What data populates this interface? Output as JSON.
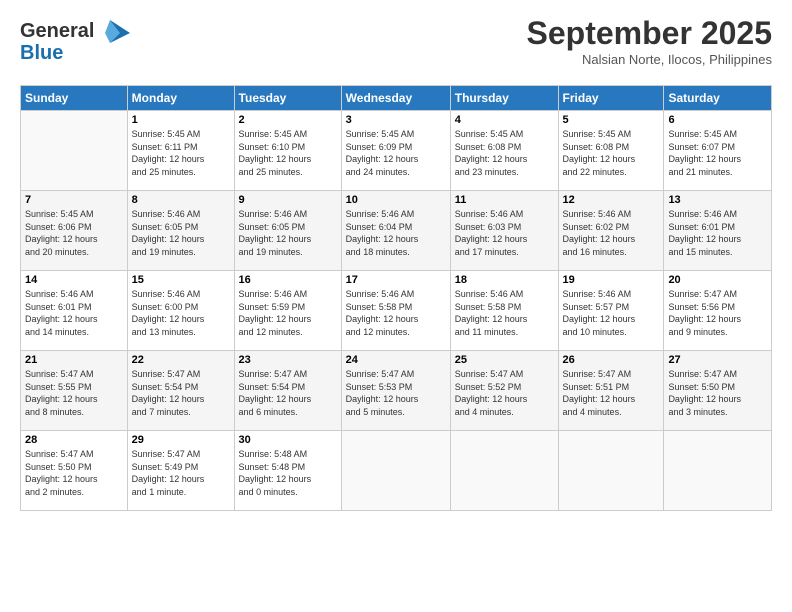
{
  "header": {
    "logo_line1": "General",
    "logo_line2": "Blue",
    "month": "September 2025",
    "location": "Nalsian Norte, Ilocos, Philippines"
  },
  "days_of_week": [
    "Sunday",
    "Monday",
    "Tuesday",
    "Wednesday",
    "Thursday",
    "Friday",
    "Saturday"
  ],
  "weeks": [
    [
      {
        "day": "",
        "info": ""
      },
      {
        "day": "1",
        "info": "Sunrise: 5:45 AM\nSunset: 6:11 PM\nDaylight: 12 hours\nand 25 minutes."
      },
      {
        "day": "2",
        "info": "Sunrise: 5:45 AM\nSunset: 6:10 PM\nDaylight: 12 hours\nand 25 minutes."
      },
      {
        "day": "3",
        "info": "Sunrise: 5:45 AM\nSunset: 6:09 PM\nDaylight: 12 hours\nand 24 minutes."
      },
      {
        "day": "4",
        "info": "Sunrise: 5:45 AM\nSunset: 6:08 PM\nDaylight: 12 hours\nand 23 minutes."
      },
      {
        "day": "5",
        "info": "Sunrise: 5:45 AM\nSunset: 6:08 PM\nDaylight: 12 hours\nand 22 minutes."
      },
      {
        "day": "6",
        "info": "Sunrise: 5:45 AM\nSunset: 6:07 PM\nDaylight: 12 hours\nand 21 minutes."
      }
    ],
    [
      {
        "day": "7",
        "info": "Sunrise: 5:45 AM\nSunset: 6:06 PM\nDaylight: 12 hours\nand 20 minutes."
      },
      {
        "day": "8",
        "info": "Sunrise: 5:46 AM\nSunset: 6:05 PM\nDaylight: 12 hours\nand 19 minutes."
      },
      {
        "day": "9",
        "info": "Sunrise: 5:46 AM\nSunset: 6:05 PM\nDaylight: 12 hours\nand 19 minutes."
      },
      {
        "day": "10",
        "info": "Sunrise: 5:46 AM\nSunset: 6:04 PM\nDaylight: 12 hours\nand 18 minutes."
      },
      {
        "day": "11",
        "info": "Sunrise: 5:46 AM\nSunset: 6:03 PM\nDaylight: 12 hours\nand 17 minutes."
      },
      {
        "day": "12",
        "info": "Sunrise: 5:46 AM\nSunset: 6:02 PM\nDaylight: 12 hours\nand 16 minutes."
      },
      {
        "day": "13",
        "info": "Sunrise: 5:46 AM\nSunset: 6:01 PM\nDaylight: 12 hours\nand 15 minutes."
      }
    ],
    [
      {
        "day": "14",
        "info": "Sunrise: 5:46 AM\nSunset: 6:01 PM\nDaylight: 12 hours\nand 14 minutes."
      },
      {
        "day": "15",
        "info": "Sunrise: 5:46 AM\nSunset: 6:00 PM\nDaylight: 12 hours\nand 13 minutes."
      },
      {
        "day": "16",
        "info": "Sunrise: 5:46 AM\nSunset: 5:59 PM\nDaylight: 12 hours\nand 12 minutes."
      },
      {
        "day": "17",
        "info": "Sunrise: 5:46 AM\nSunset: 5:58 PM\nDaylight: 12 hours\nand 12 minutes."
      },
      {
        "day": "18",
        "info": "Sunrise: 5:46 AM\nSunset: 5:58 PM\nDaylight: 12 hours\nand 11 minutes."
      },
      {
        "day": "19",
        "info": "Sunrise: 5:46 AM\nSunset: 5:57 PM\nDaylight: 12 hours\nand 10 minutes."
      },
      {
        "day": "20",
        "info": "Sunrise: 5:47 AM\nSunset: 5:56 PM\nDaylight: 12 hours\nand 9 minutes."
      }
    ],
    [
      {
        "day": "21",
        "info": "Sunrise: 5:47 AM\nSunset: 5:55 PM\nDaylight: 12 hours\nand 8 minutes."
      },
      {
        "day": "22",
        "info": "Sunrise: 5:47 AM\nSunset: 5:54 PM\nDaylight: 12 hours\nand 7 minutes."
      },
      {
        "day": "23",
        "info": "Sunrise: 5:47 AM\nSunset: 5:54 PM\nDaylight: 12 hours\nand 6 minutes."
      },
      {
        "day": "24",
        "info": "Sunrise: 5:47 AM\nSunset: 5:53 PM\nDaylight: 12 hours\nand 5 minutes."
      },
      {
        "day": "25",
        "info": "Sunrise: 5:47 AM\nSunset: 5:52 PM\nDaylight: 12 hours\nand 4 minutes."
      },
      {
        "day": "26",
        "info": "Sunrise: 5:47 AM\nSunset: 5:51 PM\nDaylight: 12 hours\nand 4 minutes."
      },
      {
        "day": "27",
        "info": "Sunrise: 5:47 AM\nSunset: 5:50 PM\nDaylight: 12 hours\nand 3 minutes."
      }
    ],
    [
      {
        "day": "28",
        "info": "Sunrise: 5:47 AM\nSunset: 5:50 PM\nDaylight: 12 hours\nand 2 minutes."
      },
      {
        "day": "29",
        "info": "Sunrise: 5:47 AM\nSunset: 5:49 PM\nDaylight: 12 hours\nand 1 minute."
      },
      {
        "day": "30",
        "info": "Sunrise: 5:48 AM\nSunset: 5:48 PM\nDaylight: 12 hours\nand 0 minutes."
      },
      {
        "day": "",
        "info": ""
      },
      {
        "day": "",
        "info": ""
      },
      {
        "day": "",
        "info": ""
      },
      {
        "day": "",
        "info": ""
      }
    ]
  ]
}
